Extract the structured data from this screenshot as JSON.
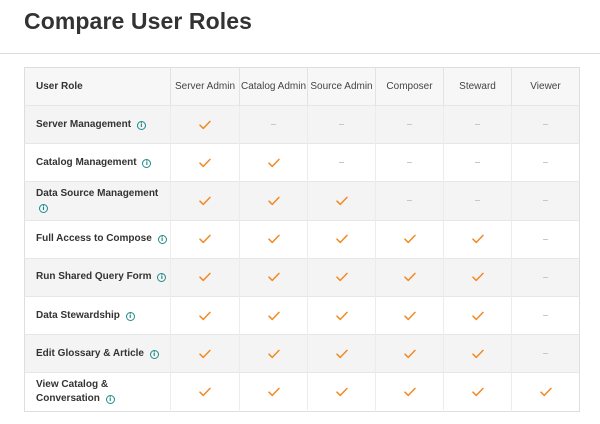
{
  "page": {
    "title": "Compare User Roles"
  },
  "colors": {
    "check": "#f08a24",
    "info": "#1f8a8a",
    "dash": "#c8c8c8"
  },
  "icons": {
    "granted": "check-icon",
    "not_granted": "dash-icon",
    "info": "info-icon"
  },
  "table": {
    "role_header": "User Role",
    "columns": [
      "Server Admin",
      "Catalog Admin",
      "Source Admin",
      "Composer",
      "Steward",
      "Viewer"
    ],
    "rows": [
      {
        "label": "Server Management",
        "values": [
          true,
          false,
          false,
          false,
          false,
          false
        ]
      },
      {
        "label": "Catalog Management",
        "values": [
          true,
          true,
          false,
          false,
          false,
          false
        ]
      },
      {
        "label": "Data Source Management",
        "values": [
          true,
          true,
          true,
          false,
          false,
          false
        ]
      },
      {
        "label": "Full Access to Compose",
        "values": [
          true,
          true,
          true,
          true,
          true,
          false
        ]
      },
      {
        "label": "Run Shared Query Form",
        "values": [
          true,
          true,
          true,
          true,
          true,
          false
        ]
      },
      {
        "label": "Data Stewardship",
        "values": [
          true,
          true,
          true,
          true,
          true,
          false
        ]
      },
      {
        "label": "Edit Glossary & Article",
        "values": [
          true,
          true,
          true,
          true,
          true,
          false
        ]
      },
      {
        "label": "View Catalog & Conversation",
        "values": [
          true,
          true,
          true,
          true,
          true,
          true
        ]
      }
    ]
  }
}
